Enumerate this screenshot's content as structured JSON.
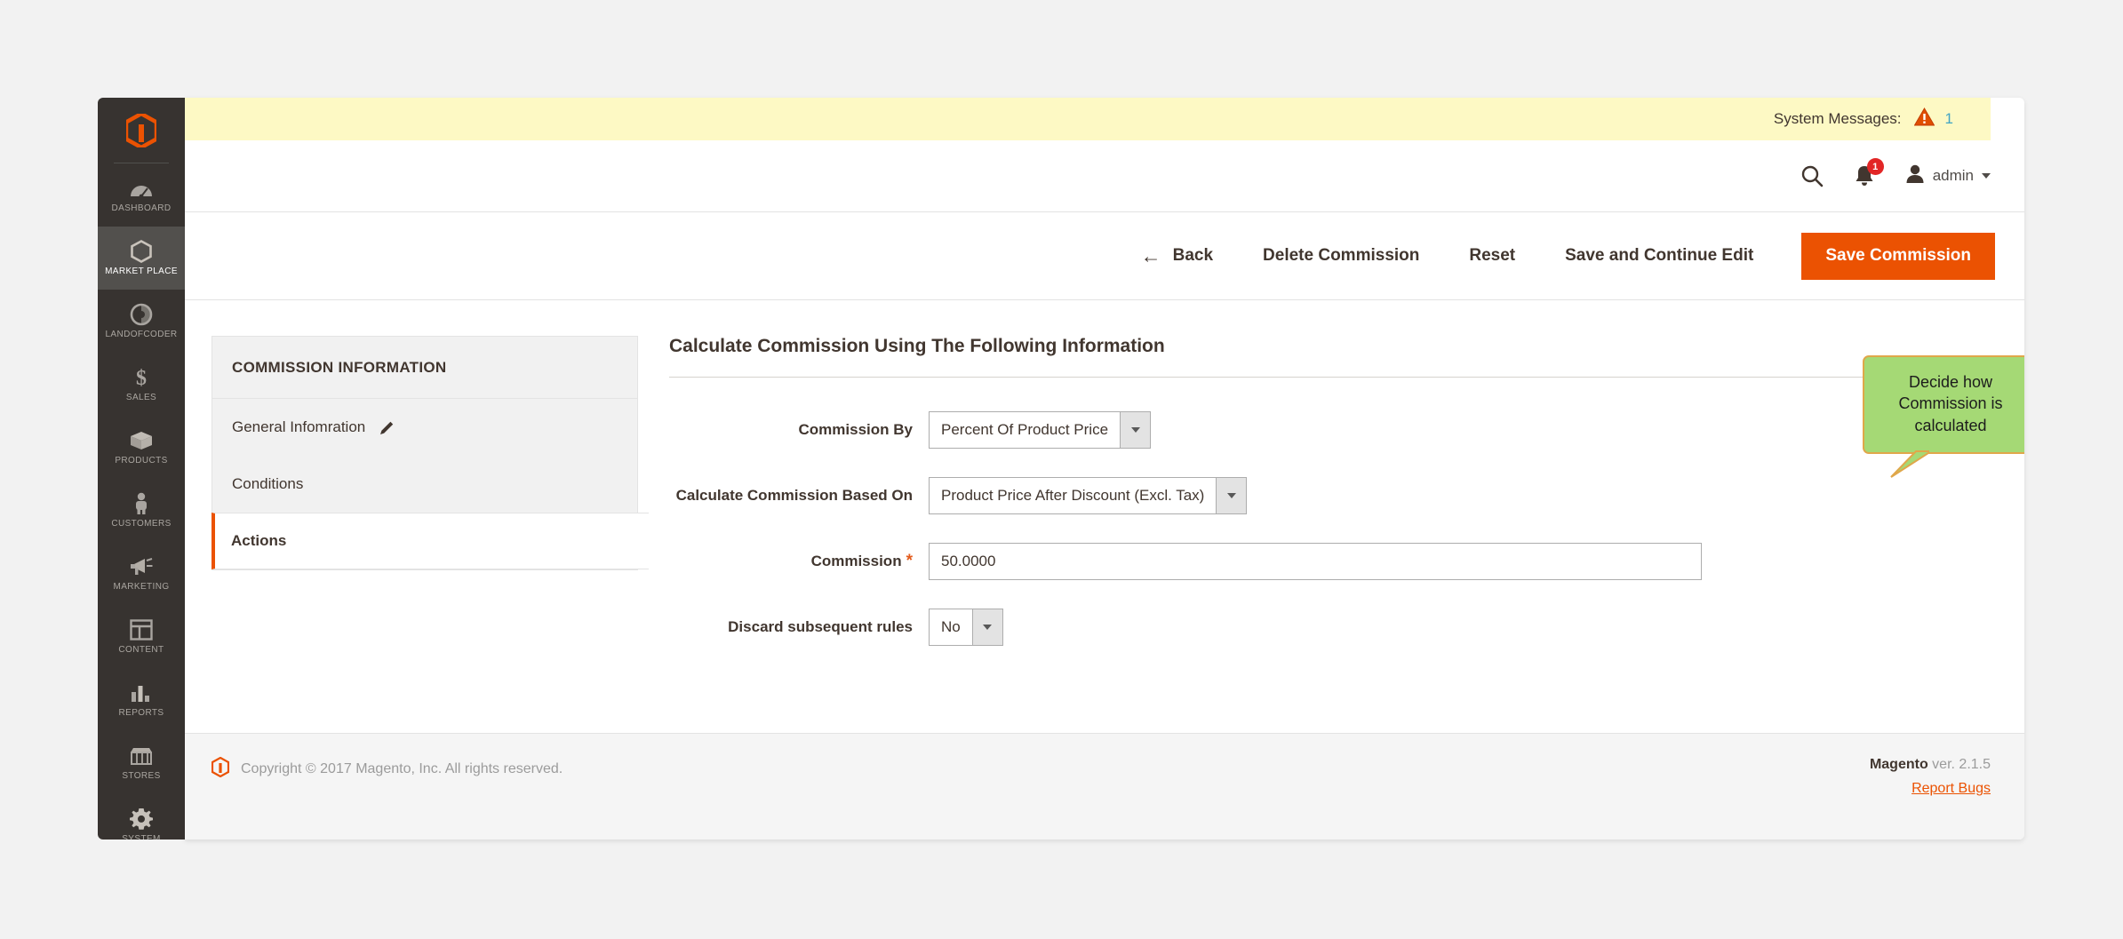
{
  "sidebar": {
    "logo_icon": "magento-logo-icon",
    "items": [
      {
        "label": "Dashboard",
        "icon": "dashboard-icon",
        "active": false
      },
      {
        "label": "Market Place",
        "icon": "marketplace-icon",
        "active": true
      },
      {
        "label": "Landofcoder",
        "icon": "landofcoder-icon",
        "active": false
      },
      {
        "label": "Sales",
        "icon": "dollar-icon",
        "active": false
      },
      {
        "label": "Products",
        "icon": "box-icon",
        "active": false
      },
      {
        "label": "Customers",
        "icon": "person-icon",
        "active": false
      },
      {
        "label": "Marketing",
        "icon": "megaphone-icon",
        "active": false
      },
      {
        "label": "Content",
        "icon": "layout-icon",
        "active": false
      },
      {
        "label": "Reports",
        "icon": "bar-chart-icon",
        "active": false
      },
      {
        "label": "Stores",
        "icon": "storefront-icon",
        "active": false
      },
      {
        "label": "System",
        "icon": "gear-icon",
        "active": false
      }
    ]
  },
  "system_messages": {
    "label": "System Messages:",
    "count": "1",
    "icon": "warning-triangle-icon"
  },
  "header": {
    "search_icon": "search-icon",
    "notifications_icon": "bell-icon",
    "notifications_count": "1",
    "user_icon": "user-avatar-icon",
    "user_name": "admin"
  },
  "page_actions": {
    "back": "Back",
    "back_icon": "arrow-left-icon",
    "delete": "Delete Commission",
    "reset": "Reset",
    "save_continue": "Save and Continue Edit",
    "save": "Save Commission"
  },
  "side_panel": {
    "title": "Commission Information",
    "items": [
      {
        "label": "General Infomration",
        "icon": "pencil-icon",
        "active": false
      },
      {
        "label": "Conditions",
        "icon": "",
        "active": false
      },
      {
        "label": "Actions",
        "icon": "",
        "active": true
      }
    ]
  },
  "form": {
    "section_title": "Calculate Commission Using The Following Information",
    "commission_by": {
      "label": "Commission By",
      "value": "Percent Of Product Price"
    },
    "based_on": {
      "label": "Calculate Commission Based On",
      "value": "Product Price After Discount (Excl. Tax)"
    },
    "commission": {
      "label": "Commission",
      "required_marker": "*",
      "value": "50.0000"
    },
    "discard_rules": {
      "label": "Discard subsequent rules",
      "value": "No"
    }
  },
  "callout": {
    "text": "Decide how Commission is calculated",
    "bg_color": "#a5d975",
    "border_color": "#e0a74a"
  },
  "footer": {
    "logo_icon": "magento-mark-icon",
    "copyright": "Copyright © 2017 Magento, Inc. All rights reserved.",
    "brand": "Magento",
    "version": " ver. 2.1.5",
    "report_bugs": "Report Bugs"
  },
  "colors": {
    "accent": "#eb5202",
    "sidebar_bg": "#373330",
    "notice_bg": "#fdf9c4",
    "page_bg": "#f2f2f2"
  }
}
